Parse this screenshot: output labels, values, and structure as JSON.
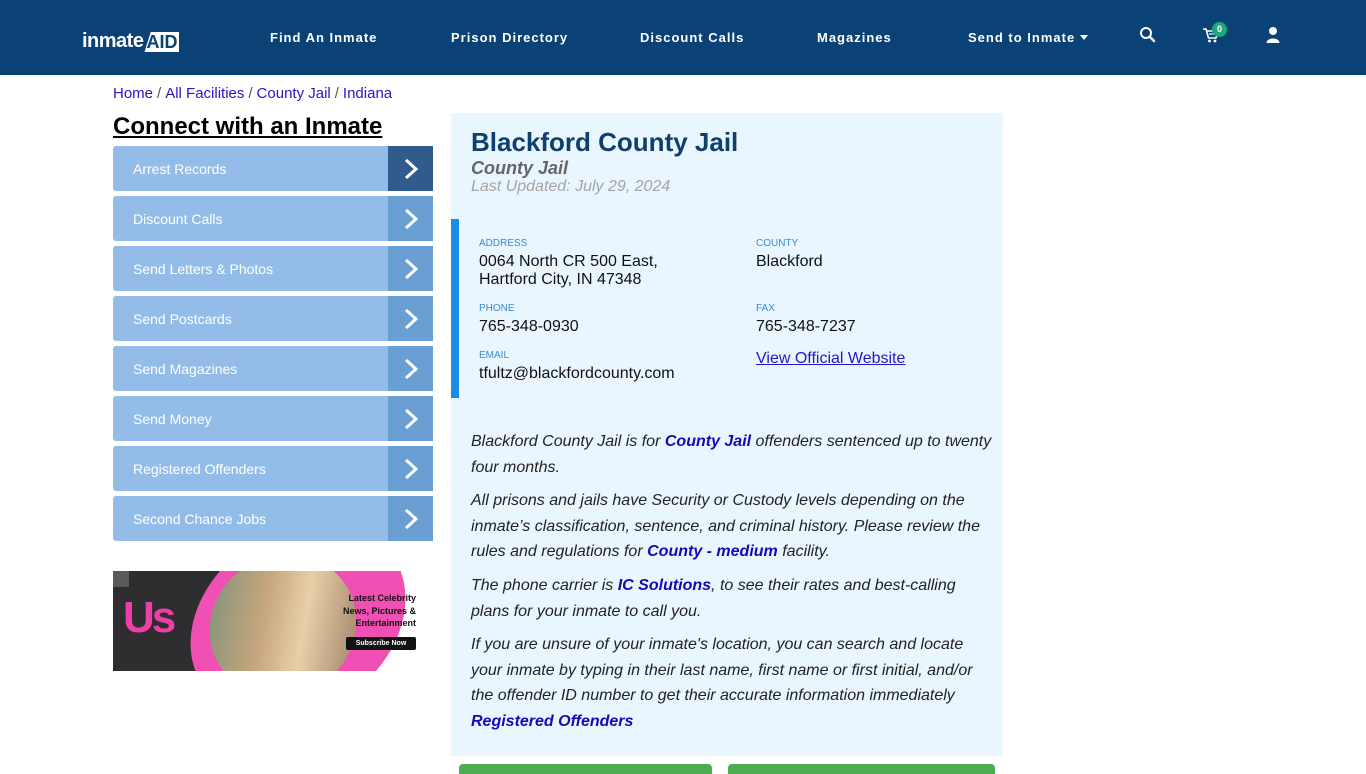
{
  "header": {
    "logo_text_1": "inmate",
    "logo_text_2": "AID",
    "nav": [
      {
        "label": "Find An Inmate"
      },
      {
        "label": "Prison Directory"
      },
      {
        "label": "Discount Calls"
      },
      {
        "label": "Magazines"
      },
      {
        "label": "Send to Inmate"
      }
    ],
    "icons": {
      "search": "search-icon",
      "cart": "cart-icon",
      "user": "user-icon"
    },
    "cart_count": "0"
  },
  "breadcrumb": [
    {
      "label": "Home"
    },
    {
      "label": "All Facilities"
    },
    {
      "label": "County Jail"
    },
    {
      "label": "Indiana"
    }
  ],
  "sidebar": {
    "title": "Connect with an Inmate",
    "items": [
      {
        "label": "Arrest Records"
      },
      {
        "label": "Discount Calls"
      },
      {
        "label": "Send Letters & Photos"
      },
      {
        "label": "Send Postcards"
      },
      {
        "label": "Send Magazines"
      },
      {
        "label": "Send Money"
      },
      {
        "label": "Registered Offenders"
      },
      {
        "label": "Second Chance Jobs"
      }
    ],
    "ad": {
      "brand": "Us",
      "line1": "Latest Celebrity",
      "line2": "News, Pictures &",
      "line3": "Entertainment",
      "cta": "Subscribe Now"
    }
  },
  "facility": {
    "name": "Blackford County Jail",
    "type": "County Jail",
    "last_updated": "Last Updated: July 29, 2024",
    "address_label": "ADDRESS",
    "address_line1": "0064 North CR 500 East,",
    "address_line2": "Hartford City, IN 47348",
    "county_label": "COUNTY",
    "county": "Blackford",
    "phone_label": "PHONE",
    "phone": "765-348-0930",
    "fax_label": "FAX",
    "fax": "765-348-7237",
    "email_label": "EMAIL",
    "email": "tfultz@blackfordcounty.com",
    "website_link": "View Official Website"
  },
  "description": {
    "p1_a": "Blackford County Jail is for ",
    "p1_link": "County Jail",
    "p1_b": " offenders sentenced up to twenty four months.",
    "p2_a": "All prisons and jails have Security or Custody levels depending on the inmate’s classification, sentence, and criminal history. Please review the rules and regulations for ",
    "p2_link": "County - medium",
    "p2_b": " facility.",
    "p3_a": "The phone carrier is ",
    "p3_link": "IC Solutions",
    "p3_b": ", to see their rates and best-calling plans for your inmate to call you.",
    "p4": "If you are unsure of your inmate's location, you can search and locate your inmate by typing in their last name, first name or first initial, and/or the offender ID number to get their accurate information immediately",
    "p4_link": "Registered Offenders"
  },
  "colors": {
    "header_bg": "#0b4276",
    "panel_bg": "#eaf6fd",
    "accent_bar": "#1a8ce8",
    "sidebar_item": "#93bde8",
    "sidebar_arrow": "#6a9fd4",
    "sidebar_arrow_active": "#305b8c",
    "link": "#1409b8",
    "green_button": "#4cae50"
  }
}
